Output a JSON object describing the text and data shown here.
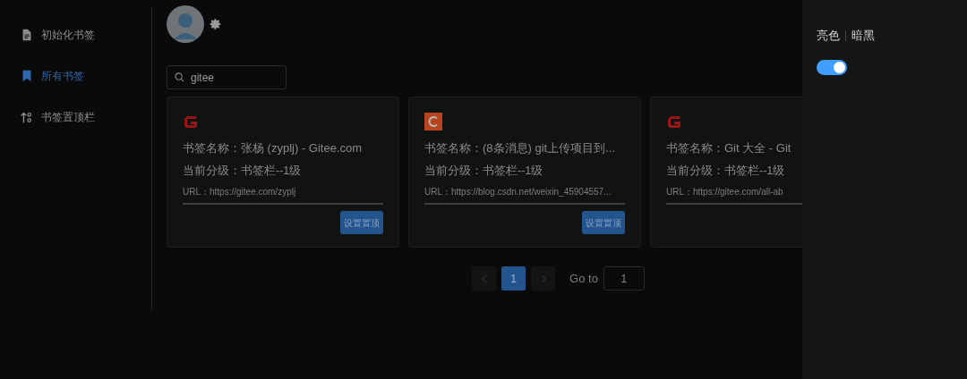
{
  "sidebar": {
    "items": [
      {
        "kind": "file",
        "label": "初始化书签",
        "selected": false
      },
      {
        "kind": "bookmark",
        "label": "所有书签",
        "selected": true
      },
      {
        "kind": "sort",
        "label": "书签置顶栏",
        "selected": false
      }
    ]
  },
  "search": {
    "value": "gitee"
  },
  "cards": [
    {
      "kind": "gitee",
      "name": "书签名称：张杨 (zyplj) - Gitee.com",
      "level": "当前分级：书签栏--1级",
      "url": "URL：https://gitee.com/zyplj",
      "button": "设置置顶"
    },
    {
      "kind": "csdn",
      "name": "书签名称：(8条消息) git上传项目到...",
      "level": "当前分级：书签栏--1级",
      "url": "URL：https://blog.csdn.net/weixin_45904557...",
      "button": "设置置顶"
    },
    {
      "kind": "gitee",
      "name": "书签名称：Git 大全 - Git",
      "level": "当前分级：书签栏--1级",
      "url": "URL：https://gitee.com/all-ab"
    }
  ],
  "pagination": {
    "pages": [
      {
        "label": "1",
        "selected": true
      }
    ],
    "goto_label": "Go to",
    "goto_value": "1"
  },
  "drawer": {
    "theme_labels": [
      "亮色",
      "暗黑"
    ],
    "toggle": {
      "on": true
    }
  }
}
